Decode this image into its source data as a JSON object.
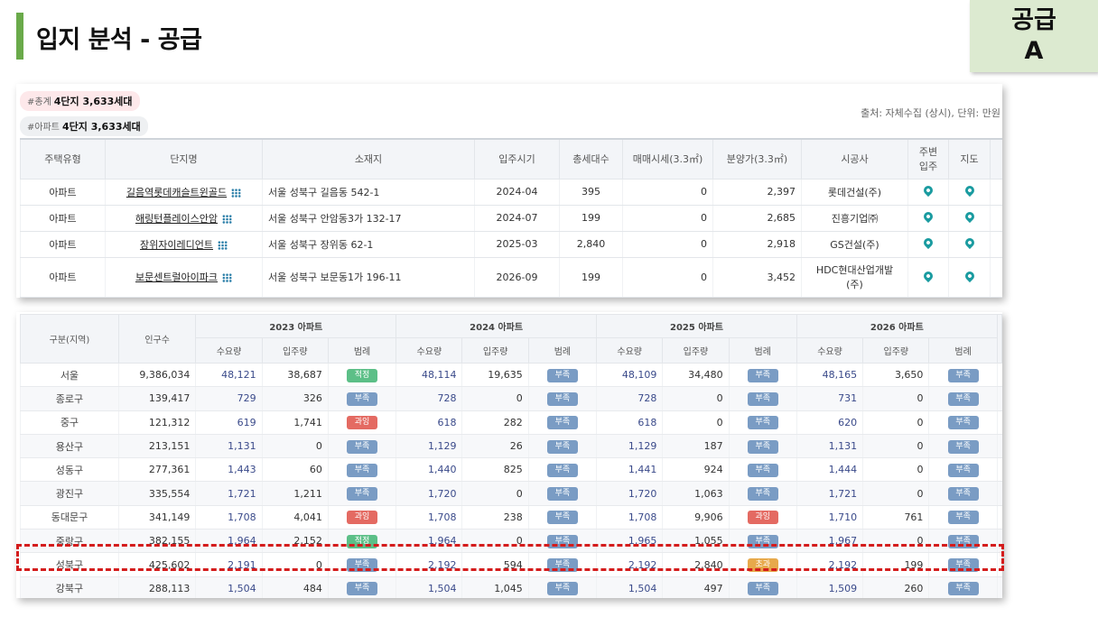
{
  "title": "입지 분석 - 공급",
  "badge": {
    "line1": "공급",
    "line2": "A"
  },
  "summary": {
    "total_key": "#총계",
    "total_value": "4단지 3,633세대",
    "apt_key": "#아파트",
    "apt_value": "4단지 3,633세대",
    "source": "출처: 자체수집 (상시), 단위: 만원"
  },
  "complex_table": {
    "headers": [
      "주택유형",
      "단지명",
      "소재지",
      "입주시기",
      "총세대수",
      "매매시세(3.3㎡)",
      "분양가(3.3㎡)",
      "시공사",
      "주변\n입주",
      "지도"
    ],
    "rows": [
      {
        "type": "아파트",
        "name": "길음역롯데캐슬트윈골드",
        "addr": "서울 성북구 길음동 542-1",
        "move": "2024-04",
        "units": "395",
        "price": "0",
        "sale": "2,397",
        "builder": "롯데건설(주)"
      },
      {
        "type": "아파트",
        "name": "해링턴플레이스안암",
        "addr": "서울 성북구 안암동3가 132-17",
        "move": "2024-07",
        "units": "199",
        "price": "0",
        "sale": "2,685",
        "builder": "진흥기업㈜"
      },
      {
        "type": "아파트",
        "name": "장위자이레디언트",
        "addr": "서울 성북구 장위동 62-1",
        "move": "2025-03",
        "units": "2,840",
        "price": "0",
        "sale": "2,918",
        "builder": "GS건설(주)"
      },
      {
        "type": "아파트",
        "name": "보문센트럴아이파크",
        "addr": "서울 성북구 보문동1가 196-11",
        "move": "2026-09",
        "units": "199",
        "price": "0",
        "sale": "3,452",
        "builder": "HDC현대산업개발\n(주)"
      }
    ]
  },
  "supply_table": {
    "h_region": "구분(지역)",
    "h_pop": "인구수",
    "years": [
      "2023 아파트",
      "2024 아파트",
      "2025 아파트",
      "2026 아파트"
    ],
    "sub": [
      "수요량",
      "입주량",
      "범례"
    ],
    "rows": [
      {
        "region": "서울",
        "pop": "9,386,034",
        "y": [
          [
            "48,121",
            "38,687",
            "적정"
          ],
          [
            "48,114",
            "19,635",
            "부족"
          ],
          [
            "48,109",
            "34,480",
            "부족"
          ],
          [
            "48,165",
            "3,650",
            "부족"
          ]
        ]
      },
      {
        "region": "종로구",
        "pop": "139,417",
        "y": [
          [
            "729",
            "326",
            "부족"
          ],
          [
            "728",
            "0",
            "부족"
          ],
          [
            "728",
            "0",
            "부족"
          ],
          [
            "731",
            "0",
            "부족"
          ]
        ]
      },
      {
        "region": "중구",
        "pop": "121,312",
        "y": [
          [
            "619",
            "1,741",
            "과잉"
          ],
          [
            "618",
            "282",
            "부족"
          ],
          [
            "618",
            "0",
            "부족"
          ],
          [
            "620",
            "0",
            "부족"
          ]
        ]
      },
      {
        "region": "용산구",
        "pop": "213,151",
        "y": [
          [
            "1,131",
            "0",
            "부족"
          ],
          [
            "1,129",
            "26",
            "부족"
          ],
          [
            "1,129",
            "187",
            "부족"
          ],
          [
            "1,131",
            "0",
            "부족"
          ]
        ]
      },
      {
        "region": "성동구",
        "pop": "277,361",
        "y": [
          [
            "1,443",
            "60",
            "부족"
          ],
          [
            "1,440",
            "825",
            "부족"
          ],
          [
            "1,441",
            "924",
            "부족"
          ],
          [
            "1,444",
            "0",
            "부족"
          ]
        ]
      },
      {
        "region": "광진구",
        "pop": "335,554",
        "y": [
          [
            "1,721",
            "1,211",
            "부족"
          ],
          [
            "1,720",
            "0",
            "부족"
          ],
          [
            "1,720",
            "1,063",
            "부족"
          ],
          [
            "1,721",
            "0",
            "부족"
          ]
        ]
      },
      {
        "region": "동대문구",
        "pop": "341,149",
        "y": [
          [
            "1,708",
            "4,041",
            "과잉"
          ],
          [
            "1,708",
            "238",
            "부족"
          ],
          [
            "1,708",
            "9,906",
            "과잉"
          ],
          [
            "1,710",
            "761",
            "부족"
          ]
        ]
      },
      {
        "region": "중랑구",
        "pop": "382,155",
        "y": [
          [
            "1,964",
            "2,152",
            "적정"
          ],
          [
            "1,964",
            "0",
            "부족"
          ],
          [
            "1,965",
            "1,055",
            "부족"
          ],
          [
            "1,967",
            "0",
            "부족"
          ]
        ]
      },
      {
        "region": "성북구",
        "pop": "425,602",
        "y": [
          [
            "2,191",
            "0",
            "부족"
          ],
          [
            "2,192",
            "594",
            "부족"
          ],
          [
            "2,192",
            "2,840",
            "초과"
          ],
          [
            "2,192",
            "199",
            "부족"
          ]
        ]
      },
      {
        "region": "강북구",
        "pop": "288,113",
        "y": [
          [
            "1,504",
            "484",
            "부족"
          ],
          [
            "1,504",
            "1,045",
            "부족"
          ],
          [
            "1,504",
            "497",
            "부족"
          ],
          [
            "1,509",
            "260",
            "부족"
          ]
        ]
      }
    ]
  }
}
